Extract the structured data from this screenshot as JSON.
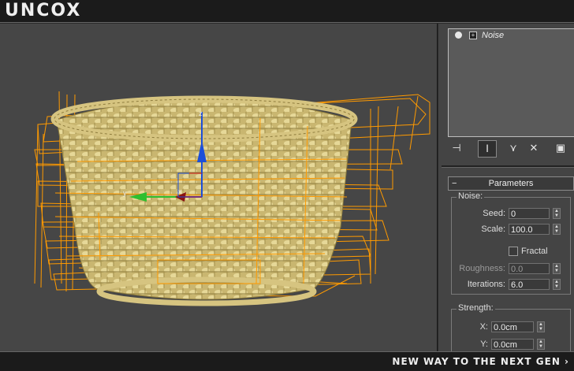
{
  "header": {
    "logo": "UNCOX"
  },
  "footer": {
    "tagline": "NEW WAY TO THE NEXT GEN ›"
  },
  "viewport": {
    "object": "wicker-basket",
    "gizmo_axes": {
      "z": "z",
      "y": "y",
      "x": "x"
    },
    "colors": {
      "background": "#464646",
      "wireframe": "#ff9a00",
      "mesh": "#c9b670",
      "axis_z": "#1d4fd8",
      "axis_y": "#2fbf2f",
      "axis_x": "#d31a1a"
    }
  },
  "modifier_stack": {
    "items": [
      {
        "name": "Noise",
        "icon": "lightbulb-icon",
        "expand_icon": "plus-icon"
      }
    ]
  },
  "stack_toolbar": {
    "icons": [
      "pin-stack-icon",
      "show-end-result-icon",
      "make-unique-icon",
      "remove-modifier-icon",
      "configure-modifier-sets-icon"
    ],
    "glyphs": [
      "⊣",
      "Ⅰ",
      "⋎",
      "✕",
      "▣"
    ]
  },
  "parameters": {
    "toggle": "−",
    "title": "Parameters",
    "noise": {
      "group_label": "Noise:",
      "seed_label": "Seed:",
      "seed_value": "0",
      "scale_label": "Scale:",
      "scale_value": "100.0",
      "fractal_label": "Fractal",
      "fractal_checked": false,
      "roughness_label": "Roughness:",
      "roughness_value": "0.0",
      "iterations_label": "Iterations:",
      "iterations_value": "6.0"
    },
    "strength": {
      "group_label": "Strength:",
      "x_label": "X:",
      "x_value": "0.0cm",
      "y_label": "Y:",
      "y_value": "0.0cm"
    }
  }
}
